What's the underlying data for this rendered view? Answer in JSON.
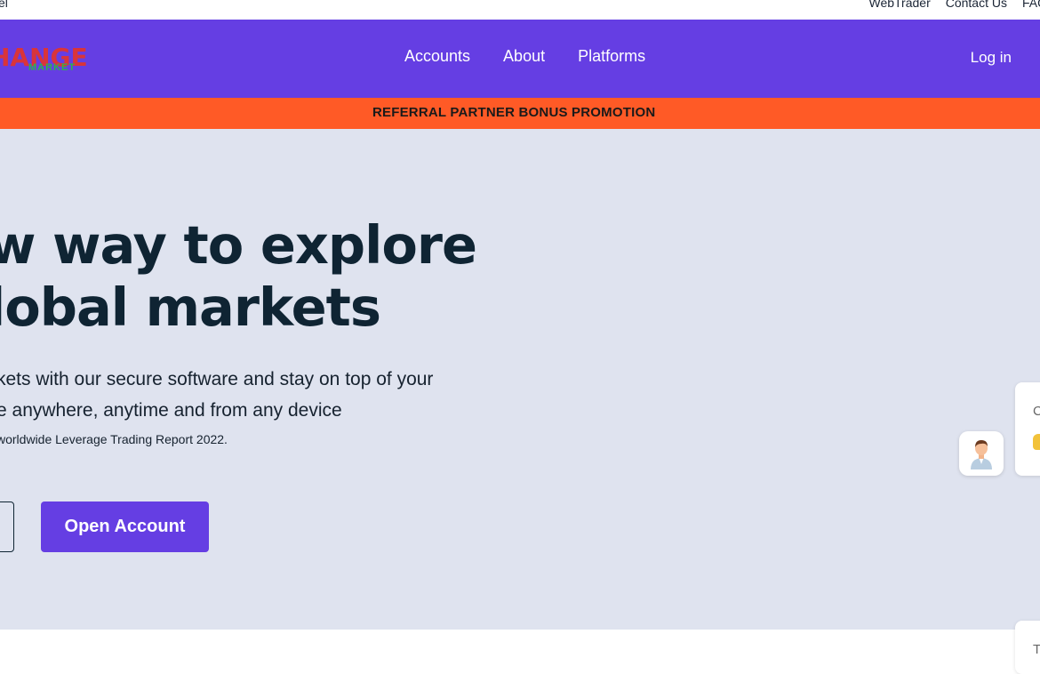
{
  "topbar": {
    "cut_text": "el",
    "links": [
      "WebTrader",
      "Contact Us",
      "FAQ"
    ]
  },
  "nav": {
    "logo_main": "HANGE",
    "logo_sub": "MARKET",
    "menu": [
      "Accounts",
      "About",
      "Platforms"
    ],
    "login": "Log in"
  },
  "promo": {
    "text": "REFERRAL PARTNER BONUS PROMOTION"
  },
  "hero": {
    "title_line1": "w way to explore",
    "title_line2": "lobal markets",
    "subtitle_line1": "kets with our secure software and stay on top of your",
    "subtitle_line2": "e anywhere, anytime and from any device",
    "note": "worldwide Leverage Trading Report 2022.",
    "primary_button": "Open Account"
  },
  "chat": {
    "bubble_text": "C",
    "bubble2_text": "T"
  },
  "colors": {
    "nav_bg": "#653ee3",
    "promo_bg": "#ff5a26",
    "hero_bg": "#dfe3ef",
    "logo_red": "#d9343a",
    "logo_green": "#2eb24d"
  }
}
